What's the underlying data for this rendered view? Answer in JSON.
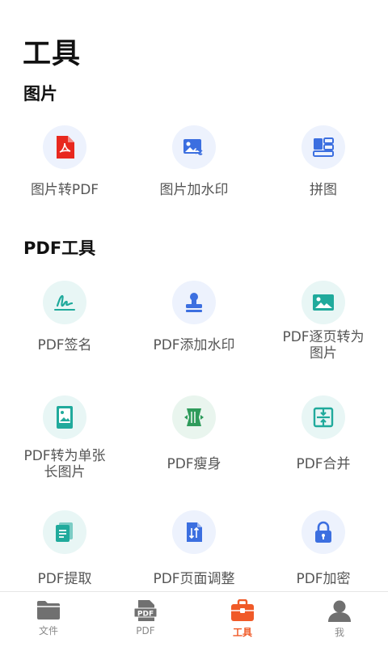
{
  "page_title": "工具",
  "sections": [
    {
      "title": "图片",
      "tools": [
        {
          "label_lines": [
            "图片转PDF"
          ],
          "icon": "pdf-file-icon"
        },
        {
          "label_lines": [
            "图片加水印"
          ],
          "icon": "image-watermark-icon"
        },
        {
          "label_lines": [
            "拼图"
          ],
          "icon": "collage-icon"
        }
      ]
    },
    {
      "title": "PDF工具",
      "tools": [
        {
          "label_lines": [
            "PDF签名"
          ],
          "icon": "signature-icon"
        },
        {
          "label_lines": [
            "PDF添加水印"
          ],
          "icon": "stamp-icon"
        },
        {
          "label_lines": [
            "PDF逐页转为",
            "图片"
          ],
          "icon": "image-icon"
        },
        {
          "label_lines": [
            "PDF转为单张",
            "长图片"
          ],
          "icon": "long-image-icon"
        },
        {
          "label_lines": [
            "PDF瘦身"
          ],
          "icon": "compress-icon"
        },
        {
          "label_lines": [
            "PDF合并"
          ],
          "icon": "merge-icon"
        },
        {
          "label_lines": [
            "PDF提取"
          ],
          "icon": "extract-icon"
        },
        {
          "label_lines": [
            "PDF页面调整"
          ],
          "icon": "page-adjust-icon"
        },
        {
          "label_lines": [
            "PDF加密"
          ],
          "icon": "lock-icon"
        }
      ]
    }
  ],
  "tabbar": [
    {
      "label": "文件",
      "icon": "folder-icon",
      "active": false
    },
    {
      "label": "PDF",
      "icon": "pdf-tab-icon",
      "active": false
    },
    {
      "label": "工具",
      "icon": "toolbox-icon",
      "active": true
    },
    {
      "label": "我",
      "icon": "user-icon",
      "active": false
    }
  ],
  "colors": {
    "accent": "#f05a28",
    "blue": "#3c6fe0",
    "teal": "#20aa9c",
    "green": "#2e9b5b",
    "red": "#e8281e"
  }
}
